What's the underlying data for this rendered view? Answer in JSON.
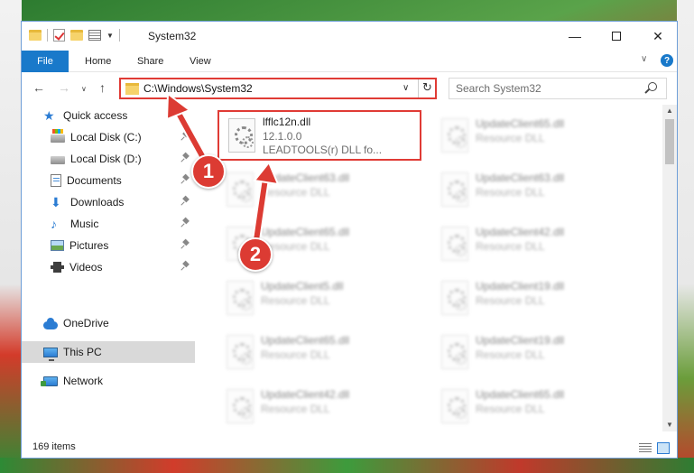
{
  "titlebar": {
    "title": "System32",
    "minimize_glyph": "—",
    "close_glyph": "✕",
    "dropdown_glyph": "▼"
  },
  "ribbon": {
    "file": "File",
    "home": "Home",
    "share": "Share",
    "view": "View",
    "expand_glyph": "∨",
    "help_glyph": "?"
  },
  "nav": {
    "back_glyph": "←",
    "forward_glyph": "→",
    "recent_glyph": "∨",
    "up_glyph": "↑",
    "address": "C:\\Windows\\System32",
    "address_dropdown_glyph": "∨",
    "refresh_glyph": "↻",
    "search_placeholder": "Search System32"
  },
  "sidebar": {
    "items": [
      {
        "label": "Quick access",
        "icon": "star-icon",
        "pinned": false
      },
      {
        "label": "Local Disk (C:)",
        "icon": "drive-c-icon",
        "pinned": true
      },
      {
        "label": "Local Disk (D:)",
        "icon": "drive-icon",
        "pinned": true
      },
      {
        "label": "Documents",
        "icon": "documents-icon",
        "pinned": true
      },
      {
        "label": "Downloads",
        "icon": "download-icon",
        "pinned": true
      },
      {
        "label": "Music",
        "icon": "music-icon",
        "pinned": true
      },
      {
        "label": "Pictures",
        "icon": "pictures-icon",
        "pinned": true
      },
      {
        "label": "Videos",
        "icon": "videos-icon",
        "pinned": true
      },
      {
        "label": "OneDrive",
        "icon": "cloud-icon",
        "pinned": false
      },
      {
        "label": "This PC",
        "icon": "computer-icon",
        "pinned": false,
        "selected": true
      },
      {
        "label": "Network",
        "icon": "network-icon",
        "pinned": false
      }
    ]
  },
  "files": {
    "highlighted": {
      "name": "lfflc12n.dll",
      "version": "12.1.0.0",
      "description": "LEADTOOLS(r) DLL fo..."
    },
    "left_column": [
      {
        "name": "UpdateClient63.dll",
        "type": "Resource DLL"
      },
      {
        "name": "UpdateClient65.dll",
        "type": "Resource DLL"
      },
      {
        "name": "UpdateClient5.dll",
        "type": "Resource DLL"
      },
      {
        "name": "UpdateClient65.dll",
        "type": "Resource DLL"
      },
      {
        "name": "UpdateClient42.dll",
        "type": "Resource DLL"
      }
    ],
    "right_column": [
      {
        "name": "UpdateClient65.dll",
        "type": "Resource DLL"
      },
      {
        "name": "UpdateClient63.dll",
        "type": "Resource DLL"
      },
      {
        "name": "UpdateClient42.dll",
        "type": "Resource DLL"
      },
      {
        "name": "UpdateClient19.dll",
        "type": "Resource DLL"
      },
      {
        "name": "UpdateClient19.dll",
        "type": "Resource DLL"
      },
      {
        "name": "UpdateClient65.dll",
        "type": "Resource DLL"
      }
    ]
  },
  "status": {
    "item_count": "169 items"
  },
  "callouts": {
    "one": "1",
    "two": "2"
  },
  "scrollbar": {
    "up_glyph": "▲",
    "down_glyph": "▼"
  },
  "colors": {
    "accent": "#1979ca",
    "highlight_border": "#e03b35",
    "callout": "#dc3b33"
  }
}
